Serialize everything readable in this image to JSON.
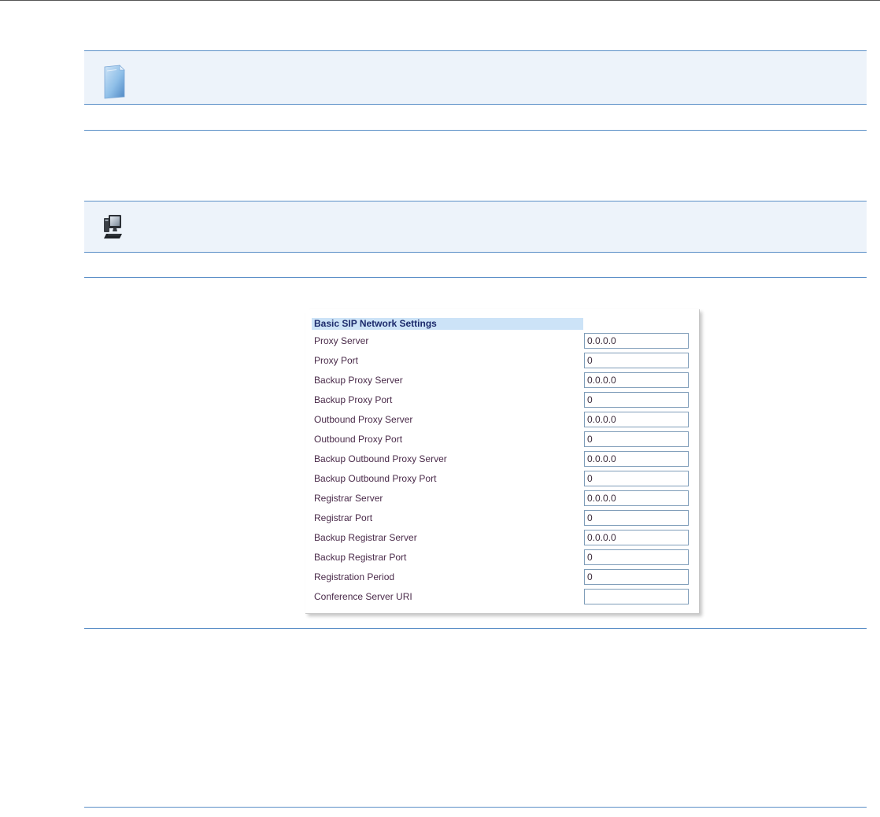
{
  "panel": {
    "title": "Basic SIP Network Settings",
    "fields": [
      {
        "label": "Proxy Server",
        "value": "0.0.0.0"
      },
      {
        "label": "Proxy Port",
        "value": "0"
      },
      {
        "label": "Backup Proxy Server",
        "value": "0.0.0.0"
      },
      {
        "label": "Backup Proxy Port",
        "value": "0"
      },
      {
        "label": "Outbound Proxy Server",
        "value": "0.0.0.0"
      },
      {
        "label": "Outbound Proxy Port",
        "value": "0"
      },
      {
        "label": "Backup Outbound Proxy Server",
        "value": "0.0.0.0"
      },
      {
        "label": "Backup Outbound Proxy Port",
        "value": "0"
      },
      {
        "label": "Registrar Server",
        "value": "0.0.0.0"
      },
      {
        "label": "Registrar Port",
        "value": "0"
      },
      {
        "label": "Backup Registrar Server",
        "value": "0.0.0.0"
      },
      {
        "label": "Backup Registrar Port",
        "value": "0"
      },
      {
        "label": "Registration Period",
        "value": "0"
      },
      {
        "label": "Conference Server URI",
        "value": ""
      }
    ]
  },
  "icons": {
    "note": "document-icon",
    "web_ui": "computer-icon"
  },
  "colors": {
    "rule": "#5b8fc7",
    "band": "#edf3fa",
    "panel_title_bg": "#cce3f7",
    "panel_title_text": "#1c2a6b",
    "label_text": "#4a2b4a",
    "input_border": "#7f9db9"
  }
}
